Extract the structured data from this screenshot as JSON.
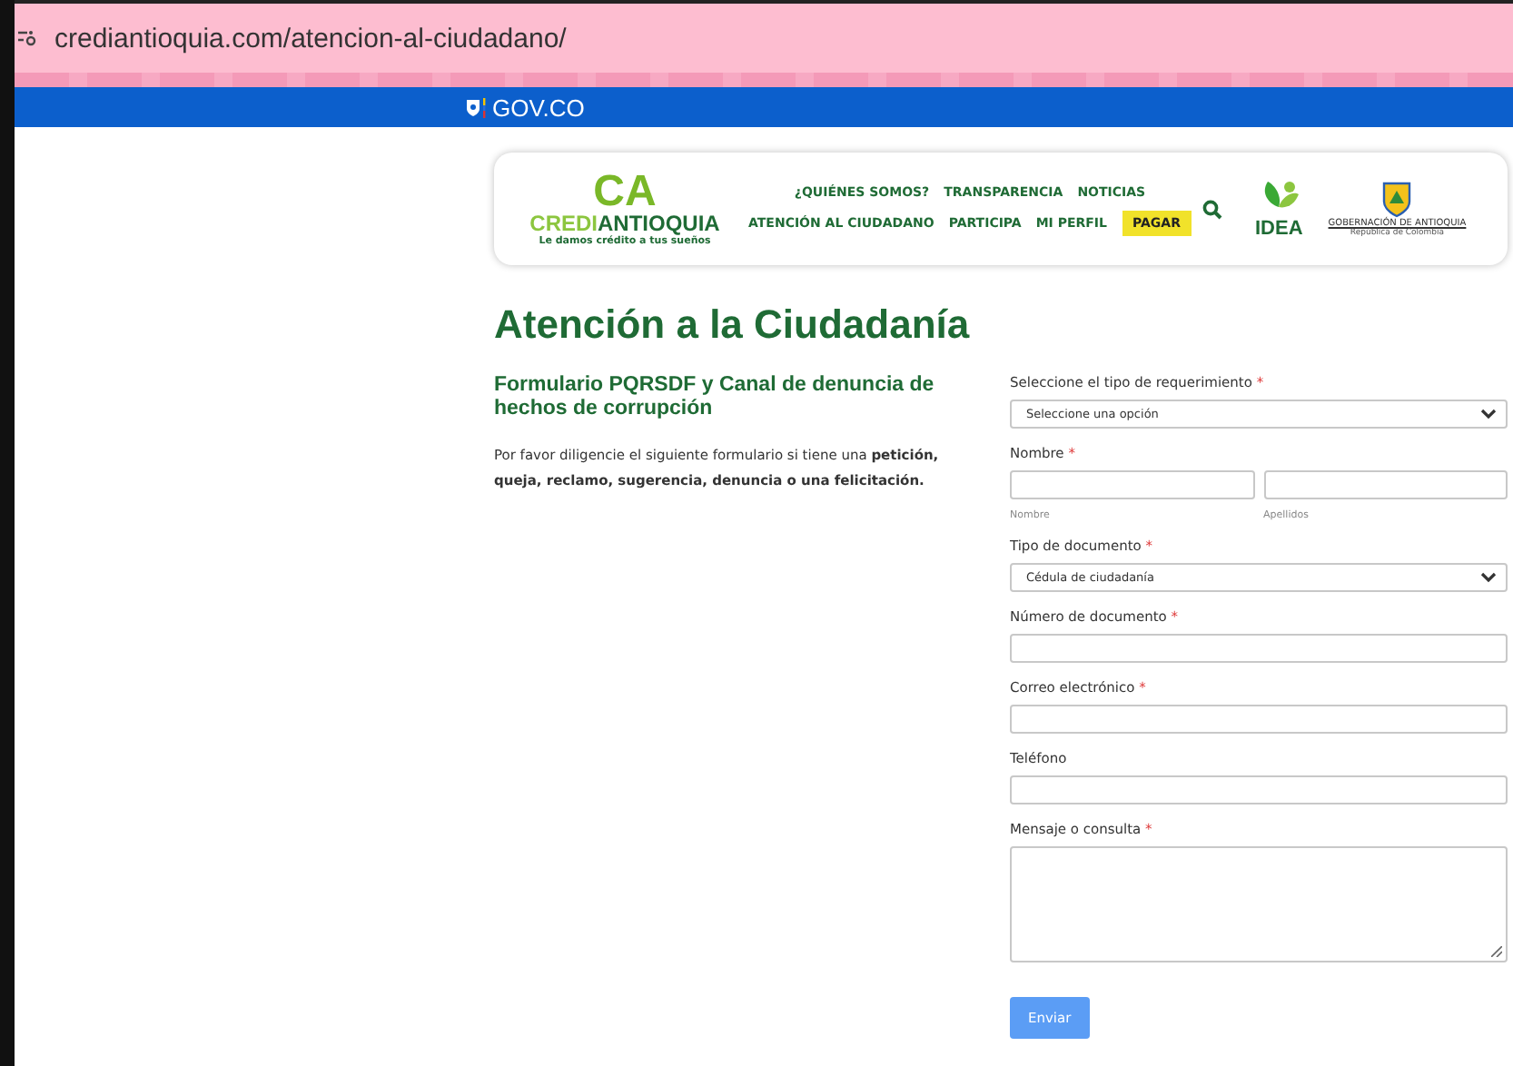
{
  "browser": {
    "url": "crediantioquia.com/atencion-al-ciudadano/"
  },
  "gov_bar": {
    "label": "GOV.CO"
  },
  "header": {
    "brand": {
      "mark": "CA",
      "first": "CREDI",
      "second": "ANTIOQUIA",
      "tagline": "Le damos crédito a tus sueños"
    },
    "nav_rows": [
      [
        {
          "label": "¿QUIÉNES SOMOS?",
          "highlighted": false
        },
        {
          "label": "TRANSPARENCIA",
          "highlighted": false
        },
        {
          "label": "NOTICIAS",
          "highlighted": false
        }
      ],
      [
        {
          "label": "ATENCIÓN AL CIUDADANO",
          "highlighted": false
        },
        {
          "label": "PARTICIPA",
          "highlighted": false
        },
        {
          "label": "MI PERFIL",
          "highlighted": false
        },
        {
          "label": "PAGAR",
          "highlighted": true
        }
      ]
    ],
    "idea_logo": "IDEA",
    "gov_logo": {
      "title": "GOBERNACIÓN DE ANTIOQUIA",
      "subtitle": "República de Colombia"
    }
  },
  "page_title": "Atención a la Ciudadanía",
  "intro": {
    "heading": "Formulario PQRSDF y Canal de denuncia de hechos de corrupción",
    "text": "Por favor diligencie el siguiente formulario si tiene una **petición, queja, reclamo, sugerencia, denuncia o una felicitación.**"
  },
  "form": {
    "fields": [
      {
        "kind": "select",
        "label": "Seleccione el tipo de requerimiento",
        "required": true,
        "value": "Seleccione una opción"
      },
      {
        "kind": "name",
        "label": "Nombre",
        "required": true,
        "hints": [
          "Nombre",
          "Apellidos"
        ]
      },
      {
        "kind": "select",
        "label": "Tipo de documento",
        "required": true,
        "value": "Cédula de ciudadanía"
      },
      {
        "kind": "text",
        "label": "Número de documento",
        "required": true
      },
      {
        "kind": "text",
        "label": "Correo electrónico",
        "required": true
      },
      {
        "kind": "text",
        "label": "Teléfono",
        "required": false
      },
      {
        "kind": "textarea",
        "label": "Mensaje o consulta",
        "required": true
      }
    ],
    "submit": "Enviar",
    "required_mark": "*"
  }
}
